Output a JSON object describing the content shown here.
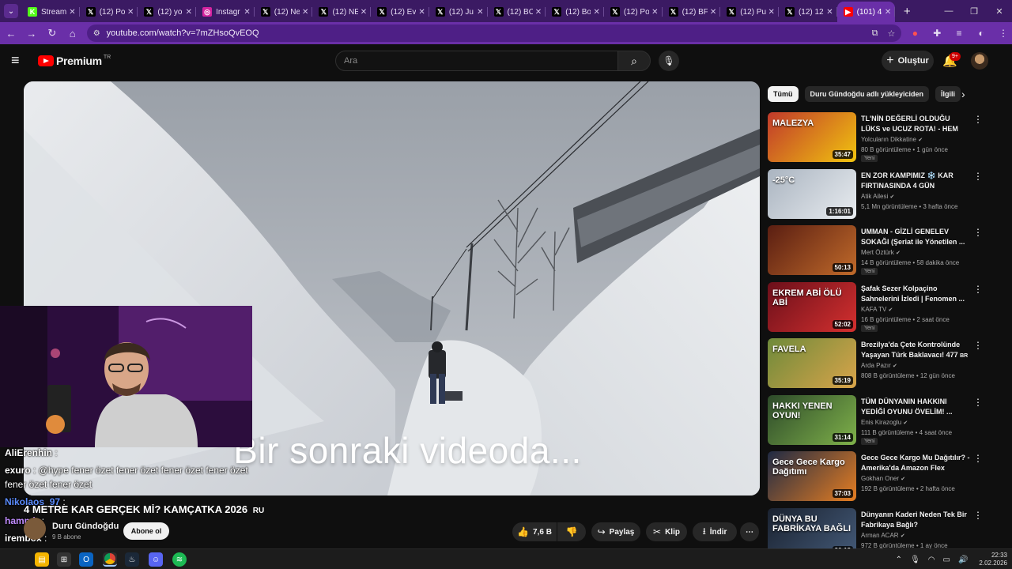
{
  "browser": {
    "tabs": [
      {
        "title": "Stream",
        "favicon": "kick-icon",
        "color": "#53fc18",
        "glyph": "K"
      },
      {
        "title": "(12) Po",
        "favicon": "x-icon",
        "color": "#000000",
        "glyph": "𝕏"
      },
      {
        "title": "(12) yo",
        "favicon": "x-icon",
        "color": "#000000",
        "glyph": "𝕏"
      },
      {
        "title": "Instagr",
        "favicon": "instagram-icon",
        "color": "#d6249f",
        "glyph": "◎"
      },
      {
        "title": "(12) Ne",
        "favicon": "x-icon",
        "color": "#000000",
        "glyph": "𝕏"
      },
      {
        "title": "(12) NE",
        "favicon": "x-icon",
        "color": "#000000",
        "glyph": "𝕏"
      },
      {
        "title": "(12) Ev",
        "favicon": "x-icon",
        "color": "#000000",
        "glyph": "𝕏"
      },
      {
        "title": "(12) Ju",
        "favicon": "x-icon",
        "color": "#000000",
        "glyph": "𝕏"
      },
      {
        "title": "(12) BC",
        "favicon": "x-icon",
        "color": "#000000",
        "glyph": "𝕏"
      },
      {
        "title": "(12) Bo",
        "favicon": "x-icon",
        "color": "#000000",
        "glyph": "𝕏"
      },
      {
        "title": "(12) Po",
        "favicon": "x-icon",
        "color": "#000000",
        "glyph": "𝕏"
      },
      {
        "title": "(12) BF",
        "favicon": "x-icon",
        "color": "#000000",
        "glyph": "𝕏"
      },
      {
        "title": "(12) Pu",
        "favicon": "x-icon",
        "color": "#000000",
        "glyph": "𝕏"
      },
      {
        "title": "(12) 12",
        "favicon": "x-icon",
        "color": "#000000",
        "glyph": "𝕏"
      },
      {
        "title": "(101) 4",
        "favicon": "youtube-icon",
        "color": "#ff0000",
        "glyph": "▶",
        "active": true
      }
    ],
    "url": "youtube.com/watch?v=7mZHsoQvEOQ"
  },
  "youtube": {
    "logo_text": "Premium",
    "country_code": "TR",
    "search_placeholder": "Ara",
    "create_label": "Oluştur",
    "notifications_badge": "9+"
  },
  "player": {
    "overlay_text": "Bir sonraki videoda..."
  },
  "chat": [
    {
      "user": "AliErenhin",
      "text": ":",
      "user_color": "#ffffff"
    },
    {
      "user": "exuro",
      "text": ": @hype fener özet fener özet fener özet fener özet",
      "user_color": "#ffffff"
    },
    {
      "user": "",
      "text": "fener özet fener özet",
      "user_color": "#ffffff"
    },
    {
      "user": "Nikolaos_97",
      "text": ":",
      "user_color": "#5b8cff"
    },
    {
      "user": "hammir",
      "text": ":",
      "user_color": "#c08cff"
    },
    {
      "user": "irembox",
      "text": ":",
      "user_color": "#ffffff"
    }
  ],
  "video": {
    "title": "4 METRE KAR GERÇEK Mİ? KAMÇATKA 2026",
    "title_suffix": "RU",
    "channel": "Duru Gündoğdu",
    "subscribers": "9 B abone",
    "subscribe_label": "Abone ol",
    "likes": "7,6 B",
    "share_label": "Paylaş",
    "clip_label": "Klip",
    "download_label": "İndir"
  },
  "chips": [
    "Tümü",
    "Duru Gündoğdu adlı yükleyiciden",
    "İlgili"
  ],
  "recommendations": [
    {
      "title": "TL'NİN DEĞERLİ OLDUĞU LÜKS ve UCUZ ROTA! - HEM VİZESİZ...",
      "channel": "Yolcuların Dikkatine",
      "meta": "80 B görüntüleme • 1 gün önce",
      "badge": "Yeni",
      "duration": "35:47",
      "thumb_text": "MALEZYA",
      "c1": "#c0392b",
      "c2": "#f1c40f"
    },
    {
      "title": "EN ZOR KAMPIMIZ ❄️ KAR FIRTINASINDA 4 GÜN",
      "channel": "Atik Ailesi",
      "meta": "5,1 Mn görüntüleme • 3 hafta önce",
      "badge": "",
      "duration": "1:16:01",
      "thumb_text": "-25°C",
      "c1": "#aab4c0",
      "c2": "#e8ecf0"
    },
    {
      "title": "UMMAN - GİZLİ GENELEV SOKAĞI (Şeriat ile Yönetilen ...",
      "channel": "Mert Öztürk",
      "meta": "14 B görüntüleme • 58 dakika önce",
      "badge": "Yeni",
      "duration": "50:13",
      "thumb_text": "",
      "c1": "#5a1e12",
      "c2": "#c06a2a"
    },
    {
      "title": "Şafak Sezer Kolpaçino Sahnelerini İzledi | Fenomen ...",
      "channel": "KAFA TV",
      "meta": "16 B görüntüleme • 2 saat önce",
      "badge": "Yeni",
      "duration": "52:02",
      "thumb_text": "EKREM ABİ ÖLÜ ABİ",
      "c1": "#6b0f1a",
      "c2": "#d4302f"
    },
    {
      "title": "Brezilya'da Çete Kontrolünde Yaşayan Türk Baklavacı! 477",
      "title_suffix": "BR",
      "channel": "Arda Pazır",
      "meta": "808 B görüntüleme • 12 gün önce",
      "badge": "",
      "duration": "35:19",
      "thumb_text": "FAVELA",
      "c1": "#6e8a3a",
      "c2": "#d9a44a"
    },
    {
      "title": "TÜM DÜNYANIN HAKKINI YEDİĞİ OYUNU ÖVELİM! ...",
      "channel": "Enis Kirazoglu",
      "meta": "111 B görüntüleme • 4 saat önce",
      "badge": "Yeni",
      "duration": "31:14",
      "thumb_text": "HAKKI YENEN OYUN!",
      "c1": "#2d4a2a",
      "c2": "#7fb14a"
    },
    {
      "title": "Gece Gece Kargo Mu Dağıtılır? - Amerika'da Amazon Flex",
      "channel": "Gokhan Oner",
      "meta": "192 B görüntüleme • 2 hafta önce",
      "badge": "",
      "duration": "37:03",
      "thumb_text": "Gece Gece Kargo Dağıtımı",
      "c1": "#1f2a44",
      "c2": "#e67e22"
    },
    {
      "title": "Dünyanın Kaderi Neden Tek Bir Fabrikaya Bağlı?",
      "channel": "Arman ACAR",
      "meta": "972 B görüntüleme • 1 ay önce",
      "badge": "",
      "duration": "36:18",
      "thumb_text": "DÜNYA BU FABRİKAYA BAĞLI",
      "c1": "#1a2230",
      "c2": "#445a78"
    }
  ],
  "taskbar": {
    "clock_time": "22:33",
    "clock_date": "2.02.2026"
  }
}
